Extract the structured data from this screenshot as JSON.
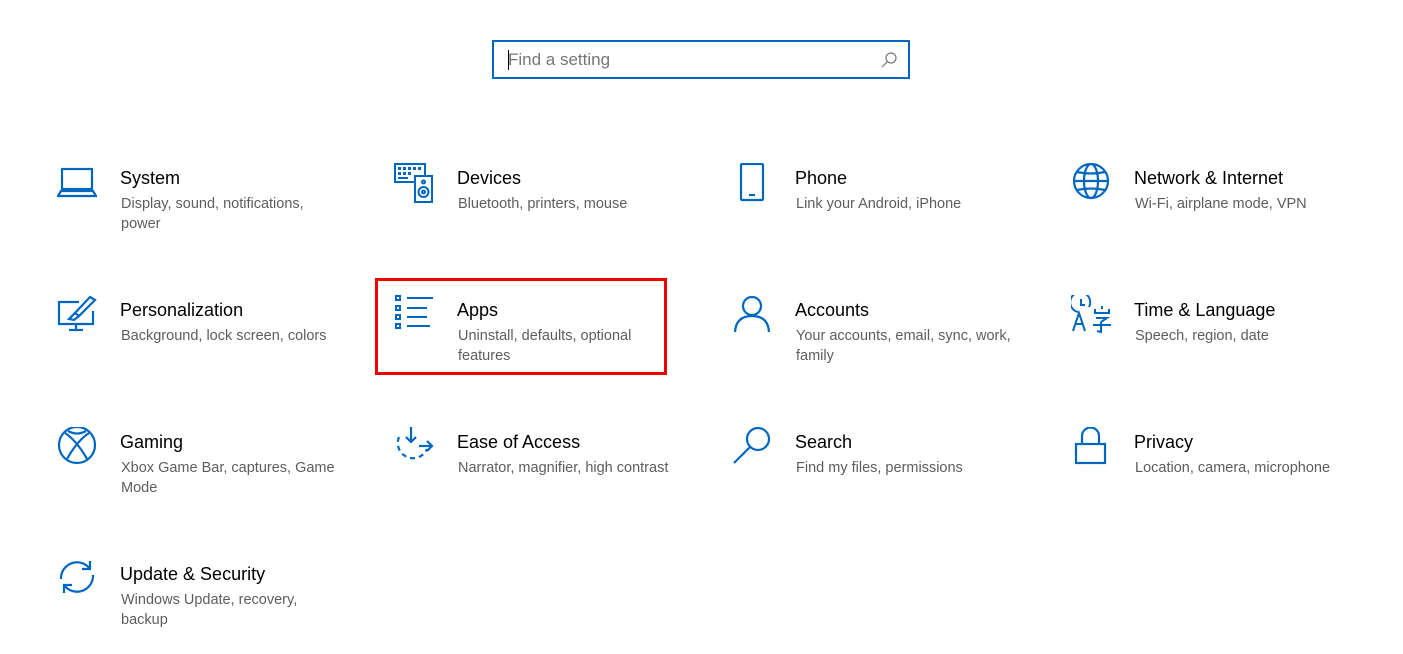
{
  "search": {
    "placeholder": "Find a setting",
    "value": "",
    "icon": "search-icon"
  },
  "accent_color": "#0067c0",
  "highlight_color": "#ee0000",
  "categories": [
    {
      "id": "system",
      "title": "System",
      "description": "Display, sound, notifications, power",
      "icon": "laptop-icon"
    },
    {
      "id": "devices",
      "title": "Devices",
      "description": "Bluetooth, printers, mouse",
      "icon": "keyboard-speaker-icon"
    },
    {
      "id": "phone",
      "title": "Phone",
      "description": "Link your Android, iPhone",
      "icon": "phone-icon"
    },
    {
      "id": "network",
      "title": "Network & Internet",
      "description": "Wi-Fi, airplane mode, VPN",
      "icon": "globe-icon"
    },
    {
      "id": "personalization",
      "title": "Personalization",
      "description": "Background, lock screen, colors",
      "icon": "paintbrush-monitor-icon"
    },
    {
      "id": "apps",
      "title": "Apps",
      "description": "Uninstall, defaults, optional features",
      "icon": "app-list-icon",
      "highlighted": true
    },
    {
      "id": "accounts",
      "title": "Accounts",
      "description": "Your accounts, email, sync, work, family",
      "icon": "person-icon"
    },
    {
      "id": "time-language",
      "title": "Time & Language",
      "description": "Speech, region, date",
      "icon": "language-clock-icon"
    },
    {
      "id": "gaming",
      "title": "Gaming",
      "description": "Xbox Game Bar, captures, Game Mode",
      "icon": "xbox-icon"
    },
    {
      "id": "ease-of-access",
      "title": "Ease of Access",
      "description": "Narrator, magnifier, high contrast",
      "icon": "ease-of-access-icon"
    },
    {
      "id": "search",
      "title": "Search",
      "description": "Find my files, permissions",
      "icon": "magnifier-icon"
    },
    {
      "id": "privacy",
      "title": "Privacy",
      "description": "Location, camera, microphone",
      "icon": "lock-icon"
    },
    {
      "id": "update-security",
      "title": "Update & Security",
      "description": "Windows Update, recovery, backup",
      "icon": "sync-arrows-icon"
    }
  ]
}
